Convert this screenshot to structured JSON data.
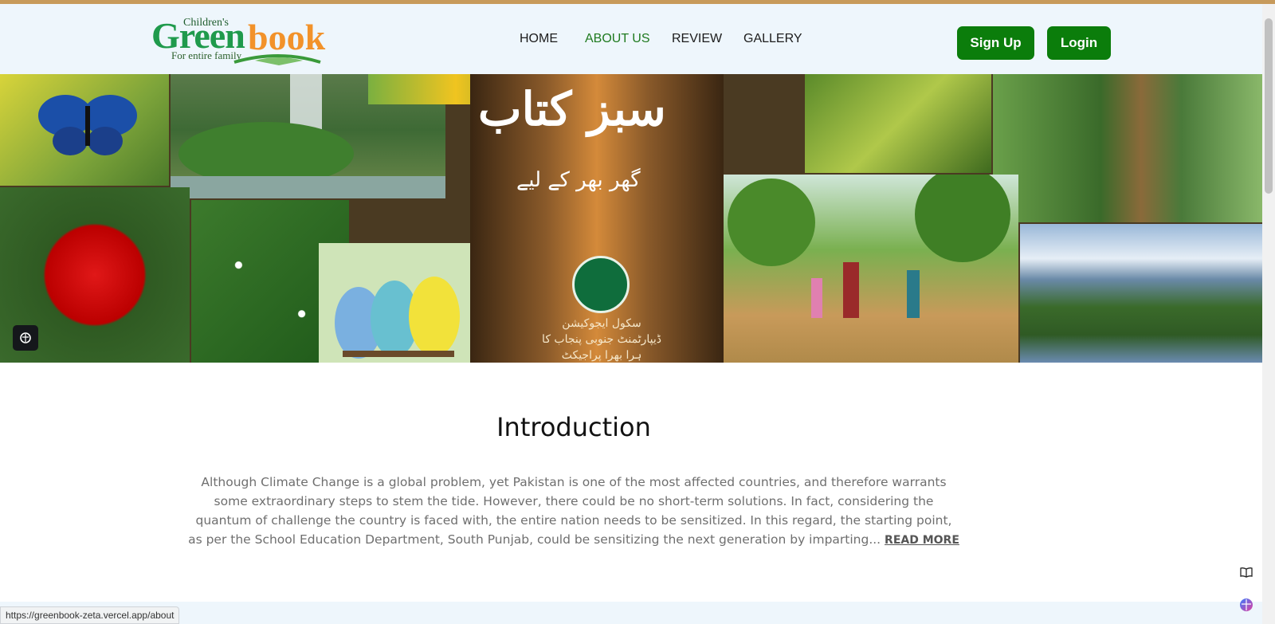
{
  "logo": {
    "children": "Children's",
    "green": "Green",
    "book": "book",
    "tagline": "For entire family"
  },
  "nav": [
    {
      "label": "HOME"
    },
    {
      "label": "ABOUT US"
    },
    {
      "label": "REVIEW"
    },
    {
      "label": "GALLERY"
    }
  ],
  "auth": {
    "signup_label": "Sign Up",
    "login_label": "Login"
  },
  "banner": {
    "urdu_title": "سبز کتاب",
    "urdu_subtitle": "گھر بھر کے لیے",
    "urdu_caption": "سکول ایجوکیشن ڈیپارٹمنٹ جنوبی پنجاب کا ہرا بھرا پراجیکٹ"
  },
  "intro": {
    "heading": "Introduction",
    "body": "Although Climate Change is a global problem, yet Pakistan is one of the most affected countries, and therefore warrants some extraordinary steps to stem the tide. However, there could be no short-term solutions. In fact, considering the quantum of challenge the country is faced with, the entire nation needs to be sensitized. In this regard, the starting point, as per the School Education Department, South Punjab, could be sensitizing the next generation by imparting... ",
    "read_more": "READ MORE"
  },
  "status_bar": {
    "url": "https://greenbook-zeta.vercel.app/about"
  },
  "icons": {
    "ai": "brain-icon",
    "book": "book-icon",
    "assistant": "brain-gradient-icon"
  },
  "colors": {
    "header_bg": "#eef6fc",
    "active_nav": "#1f7a1f",
    "button_bg": "#0b7d0b",
    "logo_green": "#1f9a4c",
    "logo_orange": "#f2922a"
  }
}
